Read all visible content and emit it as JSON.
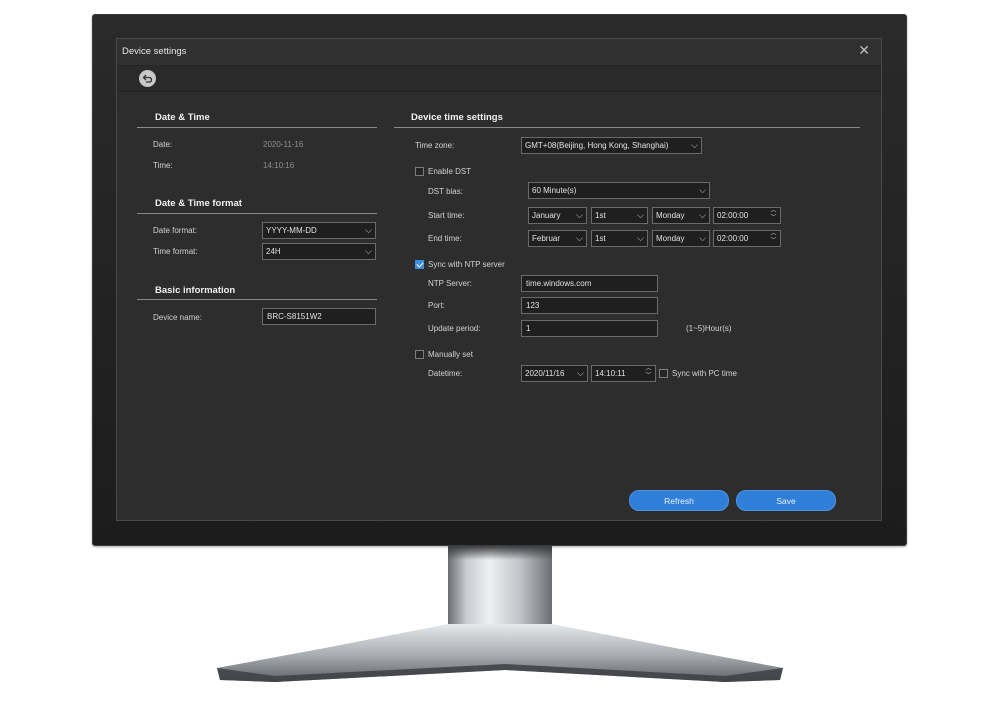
{
  "window": {
    "title": "Device settings",
    "close_glyph": "✕"
  },
  "toolbar": {
    "back_icon": "back-arrow-icon"
  },
  "date_time": {
    "heading": "Date & Time",
    "date_label": "Date:",
    "date_value": "2020-11-16",
    "time_label": "Time:",
    "time_value": "14:10:16"
  },
  "format": {
    "heading": "Date & Time format",
    "date_format_label": "Date format:",
    "date_format_value": "YYYY-MM-DD",
    "time_format_label": "Time format:",
    "time_format_value": "24H"
  },
  "basic": {
    "heading": "Basic information",
    "device_name_label": "Device name:",
    "device_name_value": "BRC-S8151W2"
  },
  "device_time": {
    "heading": "Device time settings",
    "timezone_label": "Time zone:",
    "timezone_value": "GMT+08(Beijing, Hong Kong, Shanghai)",
    "dst": {
      "label": "Enable DST",
      "checked": false,
      "bias_label": "DST bias:",
      "bias_value": "60 Minute(s)",
      "start_label": "Start time:",
      "start_month": "January",
      "start_week": "1st",
      "start_day": "Monday",
      "start_time": "02:00:00",
      "end_label": "End time:",
      "end_month": "Februar",
      "end_week": "1st",
      "end_day": "Monday",
      "end_time": "02:00:00"
    },
    "ntp": {
      "label": "Sync with NTP server",
      "checked": true,
      "server_label": "NTP Server:",
      "server_value": "time.windows.com",
      "port_label": "Port:",
      "port_value": "123",
      "period_label": "Update period:",
      "period_value": "1",
      "period_hint": "(1~5)Hour(s)"
    },
    "manual": {
      "label": "Manually set",
      "checked": false,
      "datetime_label": "Datetime:",
      "date_value": "2020/11/16",
      "time_value": "14:10:11",
      "sync_pc_label": "Sync with PC time",
      "sync_pc_checked": false
    }
  },
  "buttons": {
    "refresh": "Refresh",
    "save": "Save"
  },
  "colors": {
    "accent": "#2f7fd8",
    "window_bg": "#2d2d2d",
    "bezel": "#1f1f1f"
  }
}
